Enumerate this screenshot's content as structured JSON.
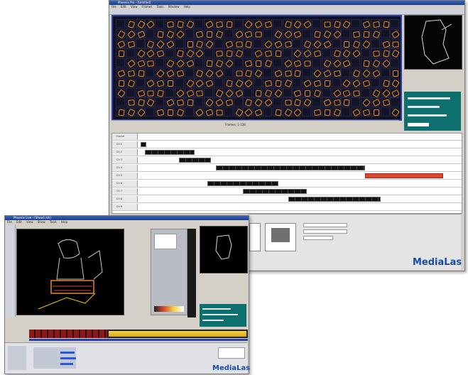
{
  "back_window": {
    "title": "Phoenix Pro - [Untitled]",
    "menu": [
      "File",
      "Edit",
      "View",
      "Frames",
      "Tools",
      "Window",
      "Help"
    ],
    "status_text": "Frames: 1-128",
    "tracks": [
      "Frame",
      "Ch 1",
      "Ch 2",
      "Ch 3",
      "Ch 4",
      "Ch 5",
      "Ch 6",
      "Ch 7",
      "Ch 8",
      "Ch 9"
    ],
    "logo": "MediaLas"
  },
  "front_window": {
    "title": "Phoenix Live - [Show1.lsh]",
    "menu": [
      "File",
      "Edit",
      "View",
      "Show",
      "Tools",
      "Help"
    ],
    "logo": "MediaLas"
  },
  "colors": {
    "accent_blue": "#2a3ea8",
    "laser_orange": "#e88a1a",
    "teal_panel": "#0e6f6f",
    "clip_red": "#d84a2c"
  }
}
